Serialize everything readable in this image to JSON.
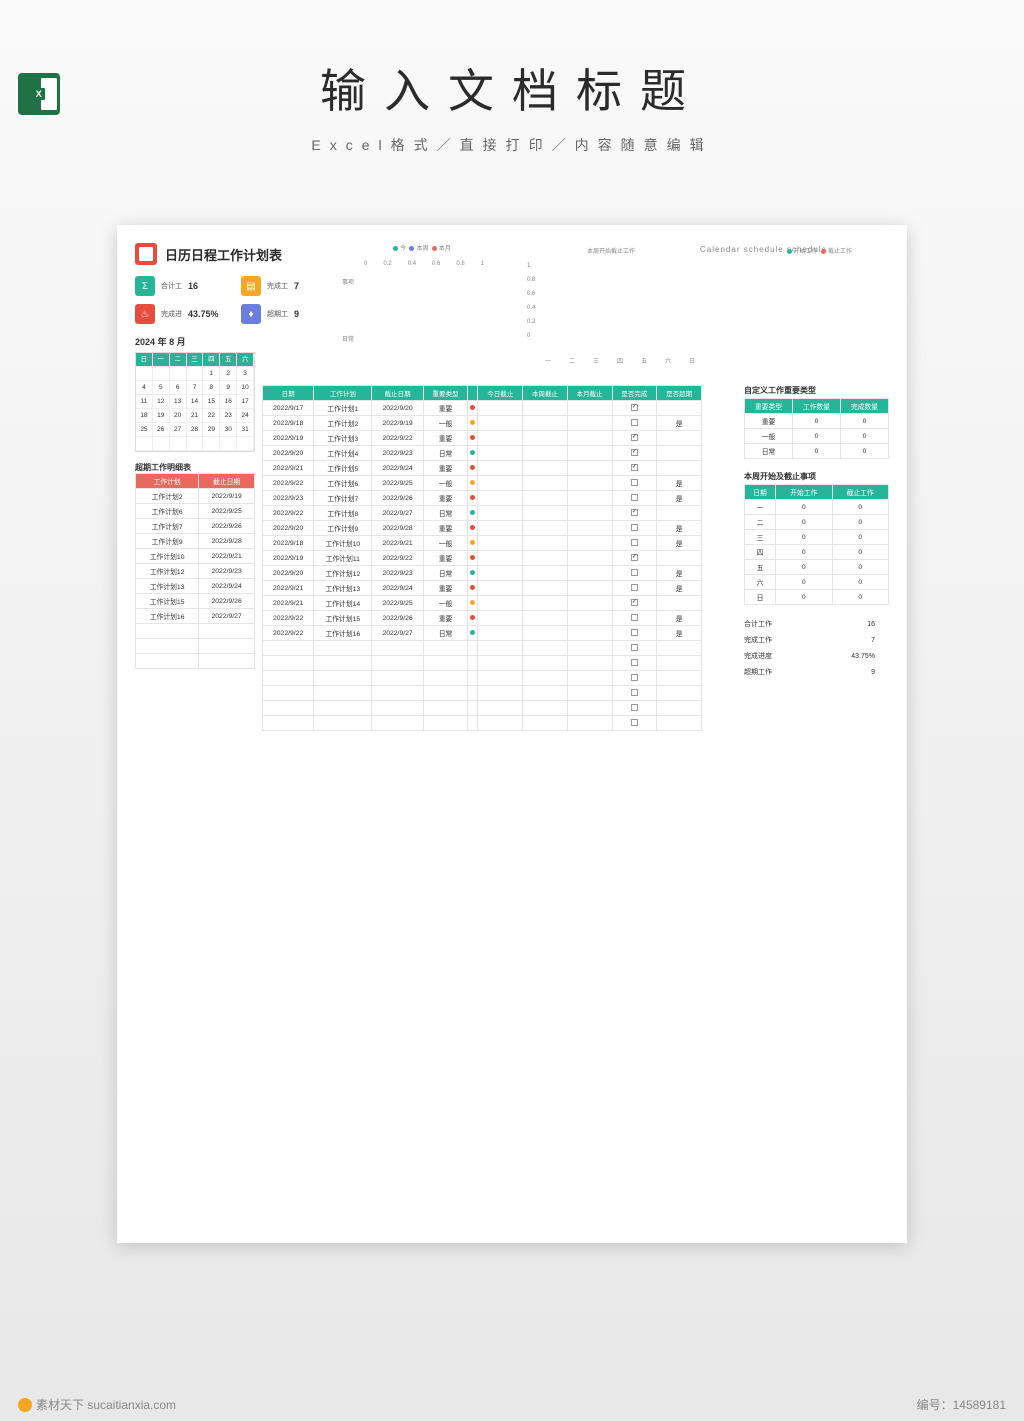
{
  "page": {
    "title": "输入文档标题",
    "subtitle": "Excel格式／直接打印／内容随意编辑",
    "excel_badge": "X"
  },
  "sheet": {
    "title": "日历日程工作计划表",
    "english_title": "Calendar schedule schedule",
    "stats": {
      "total_label": "合计工",
      "total_val": "16",
      "done_label": "完成工",
      "done_val": "7",
      "progress_label": "完成进",
      "progress_val": "43.75%",
      "overdue_label": "超期工",
      "overdue_val": "9"
    },
    "date_picker": {
      "year": "2024",
      "year_unit": "年",
      "month": "8",
      "month_unit": "月"
    },
    "calendar": {
      "days": [
        "日",
        "一",
        "二",
        "三",
        "四",
        "五",
        "六"
      ],
      "weeks": [
        [
          "",
          "",
          "",
          "",
          "1",
          "2",
          "3"
        ],
        [
          "4",
          "5",
          "6",
          "7",
          "8",
          "9",
          "10"
        ],
        [
          "11",
          "12",
          "13",
          "14",
          "15",
          "16",
          "17"
        ],
        [
          "18",
          "19",
          "20",
          "21",
          "22",
          "23",
          "24"
        ],
        [
          "25",
          "26",
          "27",
          "28",
          "29",
          "30",
          "31"
        ],
        [
          "",
          "",
          "",
          "",
          "",
          "",
          ""
        ]
      ]
    },
    "overdue_title": "超期工作明细表",
    "overdue_headers": [
      "工作计划",
      "截止日期"
    ],
    "overdue_rows": [
      [
        "工作计划2",
        "2022/9/19"
      ],
      [
        "工作计划6",
        "2022/9/25"
      ],
      [
        "工作计划7",
        "2022/9/26"
      ],
      [
        "工作计划9",
        "2022/9/28"
      ],
      [
        "工作计划10",
        "2022/9/21"
      ],
      [
        "工作计划12",
        "2022/9/23"
      ],
      [
        "工作计划13",
        "2022/9/24"
      ],
      [
        "工作计划15",
        "2022/9/26"
      ],
      [
        "工作计划16",
        "2022/9/27"
      ]
    ],
    "main_headers": [
      "日期",
      "工作计划",
      "截止日期",
      "重要类型",
      "",
      "今日截止",
      "本周截止",
      "本月截止",
      "是否完成",
      "是否超期"
    ],
    "main_rows": [
      {
        "d": "2022/9/17",
        "p": "工作计划1",
        "due": "2022/9/20",
        "t": "重要",
        "dot": "red",
        "done": true,
        "over": ""
      },
      {
        "d": "2022/9/18",
        "p": "工作计划2",
        "due": "2022/9/19",
        "t": "一般",
        "dot": "orange",
        "done": false,
        "over": "是"
      },
      {
        "d": "2022/9/19",
        "p": "工作计划3",
        "due": "2022/9/22",
        "t": "重要",
        "dot": "red",
        "done": true,
        "over": ""
      },
      {
        "d": "2022/9/20",
        "p": "工作计划4",
        "due": "2022/9/23",
        "t": "日常",
        "dot": "green",
        "done": true,
        "over": ""
      },
      {
        "d": "2022/9/21",
        "p": "工作计划5",
        "due": "2022/9/24",
        "t": "重要",
        "dot": "red",
        "done": true,
        "over": ""
      },
      {
        "d": "2022/9/22",
        "p": "工作计划6",
        "due": "2022/9/25",
        "t": "一般",
        "dot": "orange",
        "done": false,
        "over": "是"
      },
      {
        "d": "2022/9/23",
        "p": "工作计划7",
        "due": "2022/9/26",
        "t": "重要",
        "dot": "red",
        "done": false,
        "over": "是"
      },
      {
        "d": "2022/9/22",
        "p": "工作计划8",
        "due": "2022/9/27",
        "t": "日常",
        "dot": "green",
        "done": true,
        "over": ""
      },
      {
        "d": "2022/9/20",
        "p": "工作计划9",
        "due": "2022/9/28",
        "t": "重要",
        "dot": "red",
        "done": false,
        "over": "是"
      },
      {
        "d": "2022/9/18",
        "p": "工作计划10",
        "due": "2022/9/21",
        "t": "一般",
        "dot": "orange",
        "done": false,
        "over": "是"
      },
      {
        "d": "2022/9/19",
        "p": "工作计划11",
        "due": "2022/9/22",
        "t": "重要",
        "dot": "red",
        "done": true,
        "over": ""
      },
      {
        "d": "2022/9/20",
        "p": "工作计划12",
        "due": "2022/9/23",
        "t": "日常",
        "dot": "green",
        "done": false,
        "over": "是"
      },
      {
        "d": "2022/9/21",
        "p": "工作计划13",
        "due": "2022/9/24",
        "t": "重要",
        "dot": "red",
        "done": false,
        "over": "是"
      },
      {
        "d": "2022/9/21",
        "p": "工作计划14",
        "due": "2022/9/25",
        "t": "一般",
        "dot": "orange",
        "done": true,
        "over": ""
      },
      {
        "d": "2022/9/22",
        "p": "工作计划15",
        "due": "2022/9/26",
        "t": "重要",
        "dot": "red",
        "done": false,
        "over": "是"
      },
      {
        "d": "2022/9/22",
        "p": "工作计划16",
        "due": "2022/9/27",
        "t": "日常",
        "dot": "green",
        "done": false,
        "over": "是"
      }
    ],
    "right": {
      "type_title": "自定义工作重要类型",
      "type_headers": [
        "重要类型",
        "工作数量",
        "完成数量"
      ],
      "type_rows": [
        [
          "重要",
          "0",
          "0"
        ],
        [
          "一般",
          "0",
          "0"
        ],
        [
          "日常",
          "0",
          "0"
        ]
      ],
      "week_title": "本周开始及截止事项",
      "week_headers": [
        "日期",
        "开始工作",
        "截止工作"
      ],
      "week_rows": [
        [
          "一",
          "0",
          "0"
        ],
        [
          "二",
          "0",
          "0"
        ],
        [
          "三",
          "0",
          "0"
        ],
        [
          "四",
          "0",
          "0"
        ],
        [
          "五",
          "0",
          "0"
        ],
        [
          "六",
          "0",
          "0"
        ],
        [
          "日",
          "0",
          "0"
        ]
      ],
      "summary": [
        [
          "合计工作",
          "16"
        ],
        [
          "完成工作",
          "7"
        ],
        [
          "完成进度",
          "43.75%"
        ],
        [
          "超期工作",
          "9"
        ]
      ]
    },
    "charts": {
      "left_legend": [
        "今",
        "本周",
        "本月"
      ],
      "left_axis_y": "事项",
      "left_axis_x": "日常",
      "left_ticks": [
        "0",
        "0.2",
        "0.4",
        "0.6",
        "0.8",
        "1"
      ],
      "mid_title": "本周开始截止工作",
      "mid_ticks": [
        "1",
        "0.8",
        "0.6",
        "0.4",
        "0.2",
        "0"
      ],
      "mid_x": [
        "一",
        "二",
        "三",
        "四",
        "五",
        "六",
        "日"
      ],
      "right_legend": [
        "开始工作",
        "截止工作"
      ]
    }
  },
  "chart_data": [
    {
      "type": "bar",
      "title": "",
      "categories": [
        "事项",
        "日常"
      ],
      "series": [
        {
          "name": "今",
          "values": [
            0,
            0
          ]
        },
        {
          "name": "本周",
          "values": [
            0,
            0
          ]
        },
        {
          "name": "本月",
          "values": [
            0,
            0
          ]
        }
      ],
      "xlim": [
        0,
        1
      ],
      "xticks": [
        0,
        0.2,
        0.4,
        0.6,
        0.8,
        1
      ]
    },
    {
      "type": "bar",
      "title": "本周开始截止工作",
      "categories": [
        "一",
        "二",
        "三",
        "四",
        "五",
        "六",
        "日"
      ],
      "series": [
        {
          "name": "开始工作",
          "values": [
            0,
            0,
            0,
            0,
            0,
            0,
            0
          ]
        },
        {
          "name": "截止工作",
          "values": [
            0,
            0,
            0,
            0,
            0,
            0,
            0
          ]
        }
      ],
      "ylim": [
        0,
        1
      ],
      "yticks": [
        0,
        0.2,
        0.4,
        0.6,
        0.8,
        1
      ]
    }
  ],
  "footer": {
    "brand": "素材天下 sucaitianxia.com",
    "id_label": "编号：",
    "id_val": "14589181"
  }
}
